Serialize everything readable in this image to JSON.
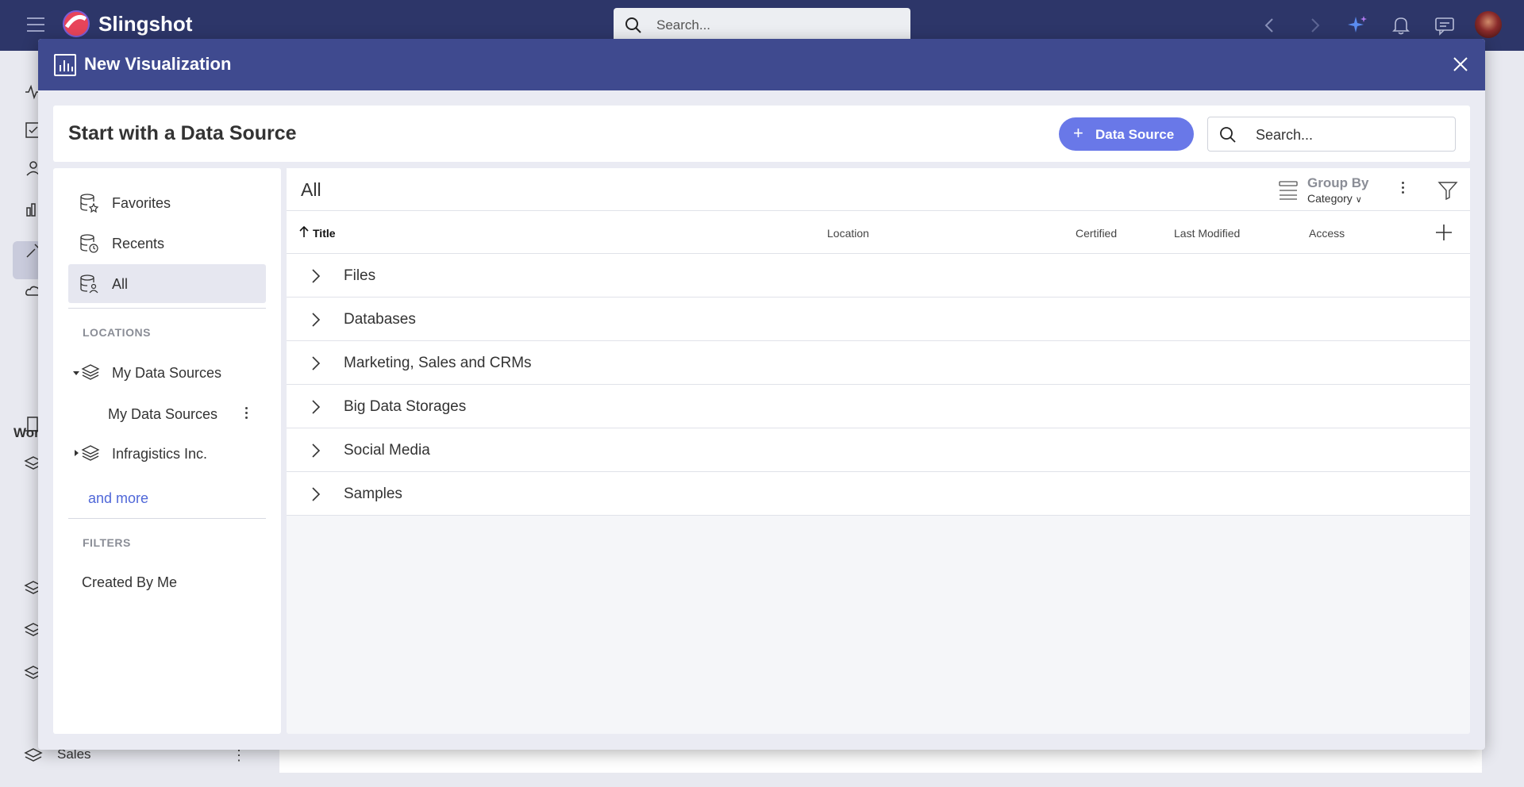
{
  "app": {
    "brand": "Slingshot",
    "search_placeholder": "Search...",
    "accent": "#2d3669"
  },
  "background": {
    "workspace_label": "Wor",
    "sales_label": "Sales"
  },
  "modal": {
    "title": "New Visualization",
    "header_color": "#3f4a8f",
    "data_source_bar": {
      "title": "Start with a Data Source",
      "add_button_label": "Data Source",
      "search_placeholder": "Search..."
    },
    "left_panel": {
      "nav": [
        {
          "label": "Favorites",
          "icon": "database-star-icon"
        },
        {
          "label": "Recents",
          "icon": "database-clock-icon"
        },
        {
          "label": "All",
          "icon": "database-user-icon",
          "active": true
        }
      ],
      "locations_heading": "LOCATIONS",
      "locations": [
        {
          "label": "My Data Sources",
          "expanded": true,
          "children": [
            "My Data Sources"
          ]
        },
        {
          "label": "Infragistics Inc.",
          "expanded": false
        }
      ],
      "and_more": "and more",
      "filters_heading": "FILTERS",
      "filters": [
        "Created By Me"
      ]
    },
    "right_panel": {
      "title": "All",
      "group_by_label": "Group By",
      "group_by_value": "Category",
      "columns": [
        "Title",
        "Location",
        "Certified",
        "Last Modified",
        "Access"
      ],
      "sort_column": "Title",
      "categories": [
        "Files",
        "Databases",
        "Marketing, Sales and CRMs",
        "Big Data Storages",
        "Social Media",
        "Samples"
      ]
    }
  }
}
